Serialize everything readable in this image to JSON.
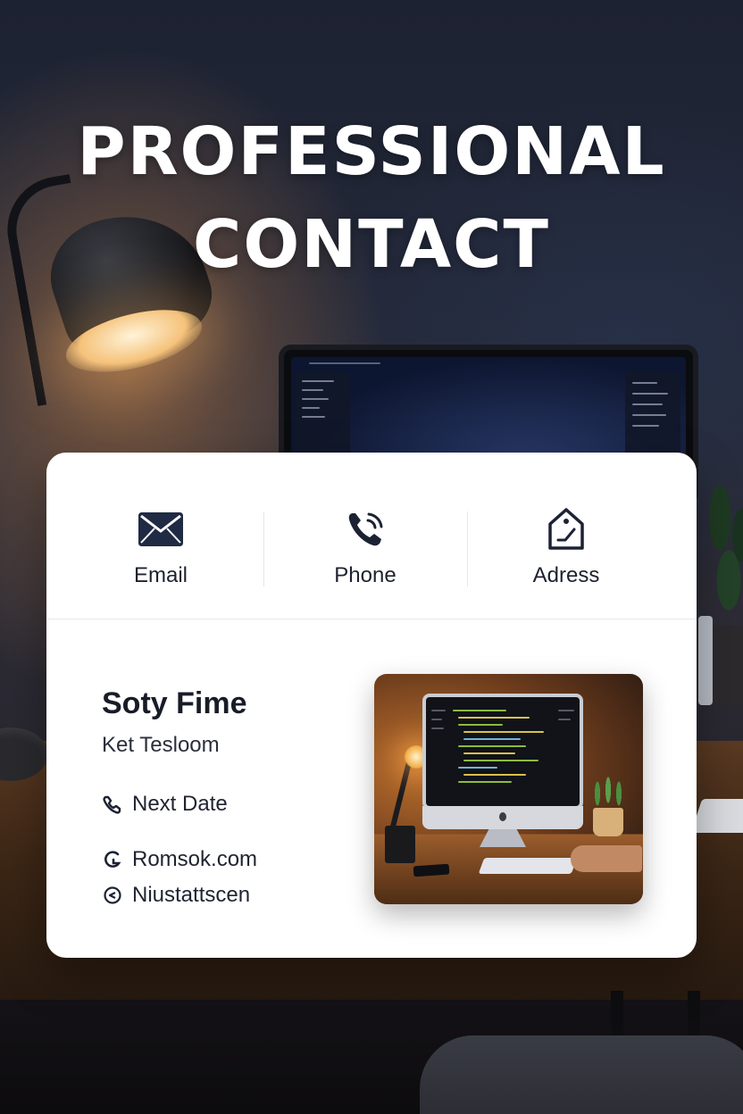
{
  "headline": {
    "line1": "PROFESSIONAL",
    "line2": "CONTACT"
  },
  "categories": [
    {
      "label": "Email",
      "icon": "envelope-icon"
    },
    {
      "label": "Phone",
      "icon": "phone-icon"
    },
    {
      "label": "Adress",
      "icon": "address-tag-icon"
    }
  ],
  "profile": {
    "name": "Soty Fime",
    "role": "Ket Tesloom",
    "rows": [
      {
        "icon": "link-icon",
        "text": "Next Date"
      },
      {
        "icon": "globe-icon",
        "text": "Romsok.com"
      },
      {
        "icon": "pin-icon",
        "text": "Niustattscen"
      }
    ]
  },
  "colors": {
    "card": "#ffffff",
    "text_dark": "#181c28",
    "background": "#1c2130",
    "lamp_glow": "#f5c27a"
  }
}
